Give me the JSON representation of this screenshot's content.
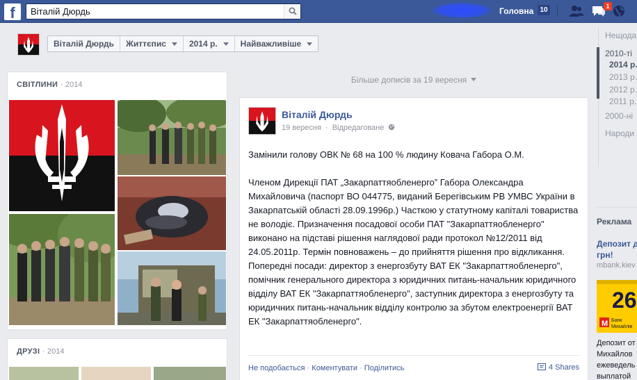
{
  "topbar": {
    "logo": "f",
    "search_value": "Віталій Дюрдь",
    "home_label": "Головна",
    "home_count": "10",
    "notifications_count": "1"
  },
  "subbar": {
    "crumbs": [
      "Віталій Дюрдь",
      "Життєпис",
      "2014 р.",
      "Найважливіше"
    ]
  },
  "photos_card": {
    "title": "СВІТЛИНИ",
    "year": "2014"
  },
  "friends_card": {
    "title": "ДРУЗІ",
    "year": "2014"
  },
  "timeline": {
    "more_posts": "Більше дописів за 19 вересня"
  },
  "post": {
    "author": "Віталій Дюрдь",
    "date": "19 вересня",
    "edited": "Відредаговане",
    "paragraph1": "Замінили голову ОВК № 68 на 100 % людину Ковача Габора О.М.",
    "paragraph2": "Членом Дирекції ПАТ „Закарпаттяобленерго” Габора Олександра Михайловича (паспорт ВО 044775, виданий Берегівським РВ УМВС України в Закарпатській області 28.09.1996р.)  Часткою у статутному капіталі товариства не володіє. Призначення посадової особи ПАТ \"Закарпаттяобленерго\" виконано на підставі рішення наглядової ради протокол №12/2011 від 24.05.2011р. Термін повноважень – до прийняття рішення про відкликання. Попередні посади: директор з енергозбуту ВАТ ЕК \"Закарпаттяобленерго\", помічник генерального директора з юридичних питань-начальник юридичного відділу ВАТ ЕК \"Закарпаттяобленерго\", заступник директора з енергозбуту та юридичних питань-начальник відділу контролю за збутом електроенергії ВАТ ЕК \"Закарпаттяобленерго\".",
    "like": "Не подобається",
    "comment": "Коментувати",
    "share": "Поділитись",
    "shares": "4 Shares"
  },
  "rail": {
    "years": [
      "Нещода",
      "2010-ті",
      "2014 р.",
      "2013 р.",
      "2012 р.",
      "2011 р.",
      "2000-ні",
      "Народи"
    ],
    "ads_title": "Реклама",
    "ad_title_line1": "Депозит д",
    "ad_title_line2": "грн!",
    "ad_domain": "mbank.kiev",
    "ad_img_number": "26",
    "ad_img_bank_line1": "Банк",
    "ad_img_bank_line2": "Михайлів",
    "ad_body_line1": "Депозит от",
    "ad_body_line2": "Михайлов",
    "ad_body_line3": "ежеведель",
    "ad_body_line4": "выплатой"
  },
  "colors": {
    "facebook_blue": "#3b5998",
    "flag_red": "#d8141e",
    "flag_black": "#111111"
  }
}
